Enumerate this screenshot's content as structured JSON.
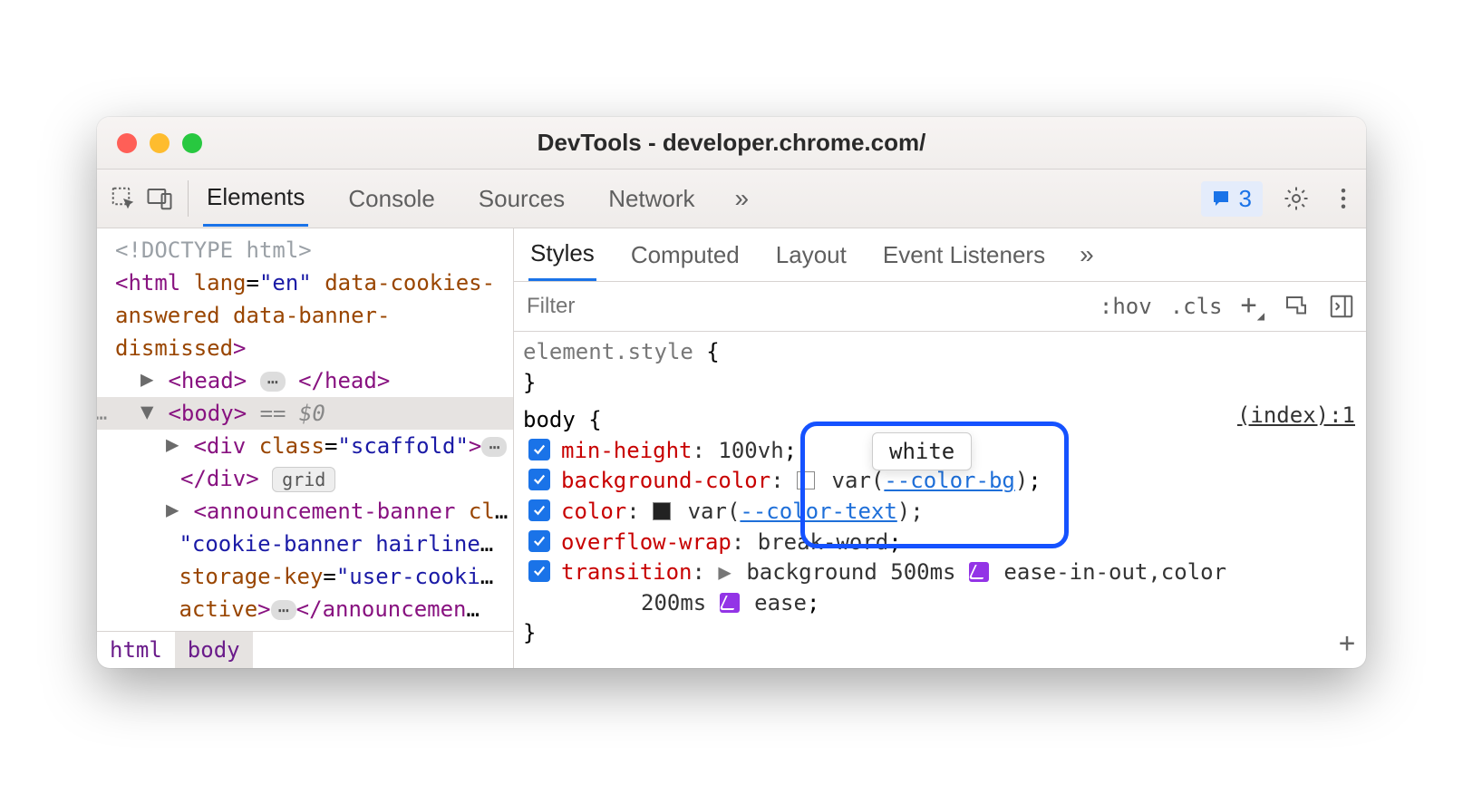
{
  "title": "DevTools - developer.chrome.com/",
  "main_tabs": [
    "Elements",
    "Console",
    "Sources",
    "Network"
  ],
  "main_tab_active": "Elements",
  "issues_count": "3",
  "dom": {
    "doctype": "<!DOCTYPE html>",
    "html_open": "<html lang=\"en\" data-cookies-answered data-banner-dismissed>",
    "head": {
      "open": "<head>",
      "close": "</head>"
    },
    "body_sel": {
      "tag": "<body>",
      "suffix": " == ",
      "var": "$0"
    },
    "div_scaffold_open": "<div class=\"scaffold\">",
    "div_scaffold_close": "</div>",
    "grid_badge": "grid",
    "ann_open": "<announcement-banner class=\"cookie-banner hairline\" storage-key=\"user-cookies\" active>",
    "ann_close": "</announcement-"
  },
  "breadcrumb": [
    "html",
    "body"
  ],
  "sub_tabs": [
    "Styles",
    "Computed",
    "Layout",
    "Event Listeners"
  ],
  "sub_tab_active": "Styles",
  "filter_placeholder": "Filter",
  "style_buttons": {
    "hov": ":hov",
    "cls": ".cls"
  },
  "element_style": {
    "selector": "element.style",
    "open": "{",
    "close": "}"
  },
  "rule_source": "(index):1",
  "body_rule": {
    "selector": "body",
    "open": "{",
    "close": "}",
    "props": {
      "min_height": {
        "name": "min-height",
        "value": "100vh"
      },
      "background_color": {
        "name": "background-color",
        "var": "--color-bg"
      },
      "color": {
        "name": "color",
        "var": "--color-text"
      },
      "overflow_wrap": {
        "name": "overflow-wrap",
        "value": "break-word"
      },
      "transition": {
        "name": "transition",
        "line1_a": "background 500ms",
        "line1_b": "ease-in-out",
        "line1_c": ",color",
        "line2_a": "200ms",
        "line2_b": "ease"
      }
    }
  },
  "tooltip_text": "white"
}
